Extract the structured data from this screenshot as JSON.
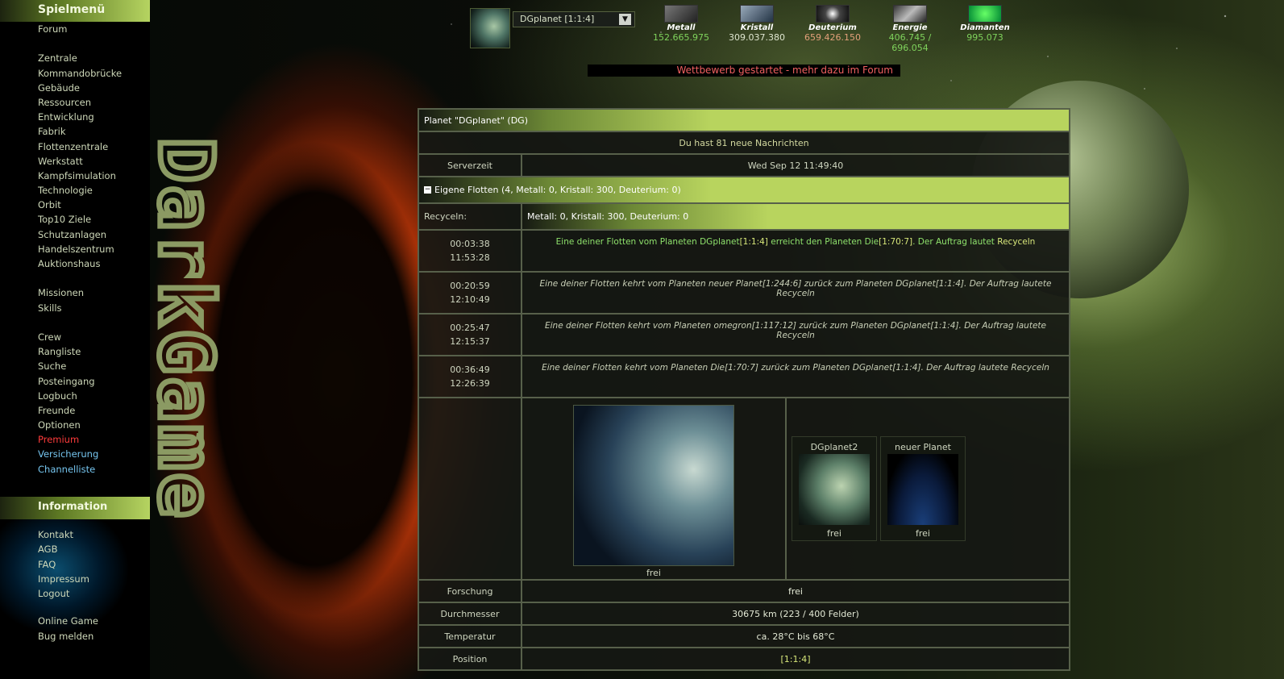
{
  "sidebar": {
    "menu_title": "Spielmenü",
    "menu_items": [
      "Forum",
      "",
      "Zentrale",
      "Kommandobrücke",
      "Gebäude",
      "Ressourcen",
      "Entwicklung",
      "Fabrik",
      "Flottenzentrale",
      "Werkstatt",
      "Kampfsimulation",
      "Technologie",
      "Orbit",
      "Top10 Ziele",
      "Schutzanlagen",
      "Handelszentrum",
      "Auktionshaus",
      "",
      "Missionen",
      "Skills",
      "",
      "Crew",
      "Rangliste",
      "Suche",
      "Posteingang",
      "Logbuch",
      "Freunde",
      "Optionen",
      "Premium",
      "Versicherung",
      "Channelliste"
    ],
    "info_title": "Information",
    "info_items": [
      "Kontakt",
      "AGB",
      "FAQ",
      "Impressum",
      "Logout",
      "",
      "Online Game",
      "Bug melden"
    ]
  },
  "header": {
    "planet_select": "DGplanet [1:1:4]",
    "resources": [
      {
        "name": "Metall",
        "value": "152.665.975",
        "color": "#7fd35c",
        "icon": "metal-icon"
      },
      {
        "name": "Kristall",
        "value": "309.037.380",
        "color": "#dfe6d0",
        "icon": "crystal-icon"
      },
      {
        "name": "Deuterium",
        "value": "659.426.150",
        "color": "#e3a07a",
        "icon": "deuterium-icon"
      },
      {
        "name": "Energie",
        "value": "406.745 / 696.054",
        "color": "#7fd35c",
        "icon": "energy-icon"
      },
      {
        "name": "Diamanten",
        "value": "995.073",
        "color": "#7fd35c",
        "icon": "diamond-icon"
      }
    ],
    "notice": "Wettbewerb gestartet - mehr dazu im Forum"
  },
  "main": {
    "planet_title": "Planet \"DGplanet\" (DG)",
    "messages": "Du hast 81 neue Nachrichten",
    "server_time_label": "Serverzeit",
    "server_time": "Wed Sep 12 11:49:40",
    "own_fleets": "Eigene Flotten (4, Metall: 0, Kristall: 300, Deuterium: 0)",
    "recycle_label": "Recyceln:",
    "recycle_value": "Metall: 0, Kristall: 300, Deuterium: 0",
    "fleets": [
      {
        "t1": "00:03:38",
        "t2": "11:53:28",
        "parts": [
          {
            "text": "Eine deiner Flotten vom Planeten DGplanet",
            "cls": "g"
          },
          {
            "text": "[1:1:4]",
            "cls": "y"
          },
          {
            "text": " erreicht den Planeten Die",
            "cls": "g"
          },
          {
            "text": "[1:70:7]",
            "cls": "y"
          },
          {
            "text": ". Der Auftrag lautet ",
            "cls": "g"
          },
          {
            "text": "Recyceln",
            "cls": "y"
          }
        ]
      },
      {
        "t1": "00:20:59",
        "t2": "12:10:49",
        "parts": [
          {
            "text": "Eine deiner ",
            "cls": "it"
          },
          {
            "text": "Flotten",
            "cls": "it y"
          },
          {
            "text": " kehrt vom Planeten neuer Planet",
            "cls": "it"
          },
          {
            "text": "[1:244:6]",
            "cls": "it y"
          },
          {
            "text": " zurück zum Planeten DGplanet",
            "cls": "it"
          },
          {
            "text": "[1:1:4]",
            "cls": "it y"
          },
          {
            "text": ". Der Auftrag lautete ",
            "cls": "it"
          },
          {
            "text": "Recyceln",
            "cls": "it y"
          }
        ]
      },
      {
        "t1": "00:25:47",
        "t2": "12:15:37",
        "parts": [
          {
            "text": "Eine deiner ",
            "cls": "it"
          },
          {
            "text": "Flotten",
            "cls": "it y"
          },
          {
            "text": " kehrt vom Planeten omegron",
            "cls": "it"
          },
          {
            "text": "[1:117:12]",
            "cls": "it y"
          },
          {
            "text": " zurück zum Planeten DGplanet",
            "cls": "it"
          },
          {
            "text": "[1:1:4]",
            "cls": "it y"
          },
          {
            "text": ". Der Auftrag lautete ",
            "cls": "it"
          },
          {
            "text": "Recyceln",
            "cls": "it y"
          }
        ]
      },
      {
        "t1": "00:36:49",
        "t2": "12:26:39",
        "parts": [
          {
            "text": "Eine deiner ",
            "cls": "it"
          },
          {
            "text": "Flotten",
            "cls": "it y"
          },
          {
            "text": " kehrt vom Planeten Die",
            "cls": "it"
          },
          {
            "text": "[1:70:7]",
            "cls": "it y"
          },
          {
            "text": " zurück zum Planeten DGplanet",
            "cls": "it"
          },
          {
            "text": "[1:1:4]",
            "cls": "it y"
          },
          {
            "text": ". Der Auftrag lautete ",
            "cls": "it"
          },
          {
            "text": "Recyceln",
            "cls": "it y"
          }
        ]
      }
    ],
    "planet_big_caption": "frei",
    "other_planets": [
      {
        "name": "DGplanet2",
        "caption": "frei"
      },
      {
        "name": "neuer Planet",
        "caption": "frei"
      }
    ],
    "info_rows": [
      {
        "label": "Forschung",
        "value": "frei",
        "value_color": "#e4ead6"
      },
      {
        "label": "Durchmesser",
        "value": "30675 km (223 / 400 Felder)",
        "value_color": "#e4ead6"
      },
      {
        "label": "Temperatur",
        "value": "ca. 28°C bis 68°C",
        "value_color": "#e4ead6"
      },
      {
        "label": "Position",
        "value": "[1:1:4]",
        "value_color": "#d7e77a"
      }
    ]
  }
}
